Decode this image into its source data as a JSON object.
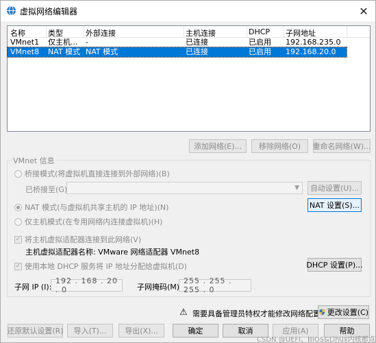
{
  "window": {
    "title": "虚拟网络编辑器",
    "close_glyph": "✕"
  },
  "table": {
    "columns": [
      "名称",
      "类型",
      "外部连接",
      "主机连接",
      "DHCP",
      "子网地址"
    ],
    "rows": [
      {
        "name": "VMnet1",
        "type": "仅主机...",
        "external": "-",
        "host": "已连接",
        "dhcp": "已启用",
        "subnet": "192.168.235.0",
        "selected": false
      },
      {
        "name": "VMnet8",
        "type": "NAT 模式",
        "external": "NAT 模式",
        "host": "已连接",
        "dhcp": "已启用",
        "subnet": "192.168.20.0",
        "selected": true
      }
    ]
  },
  "network_buttons": {
    "add": "添加网络(E)...",
    "remove": "移除网络(O)",
    "rename": "重命名网络(W)..."
  },
  "vmnet_info": {
    "group_title": "VMnet 信息",
    "bridge_label": "桥接模式(将虚拟机直接连接到外部网络)(B)",
    "bridged_to_label": "已桥接至(G):",
    "auto_settings": "自动设置(U)...",
    "nat_label": "NAT 模式(与虚拟机共享主机的 IP 地址)(N)",
    "nat_settings": "NAT 设置(S)...",
    "hostonly_label": "仅主机模式(在专用网络内连接虚拟机)(H)",
    "connect_adapter_label": "将主机虚拟适配器连接到此网络(V)",
    "adapter_name_label": "主机虚拟适配器名称: VMware 网络适配器 VMnet8",
    "dhcp_label": "使用本地 DHCP 服务将 IP 地址分配给虚拟机(D)",
    "dhcp_settings": "DHCP 设置(P)...",
    "subnet_ip_label": "子网 IP (I):",
    "subnet_ip_value": "192 . 168 . 20 . 0",
    "subnet_mask_label": "子网掩码(M):",
    "subnet_mask_value": "255 . 255 . 255 . 0"
  },
  "admin_notice": {
    "warning_glyph": "⚠",
    "text": "需要具备管理员特权才能修改网络配置。",
    "change_settings": "更改设置(C)"
  },
  "footer": {
    "restore_defaults": "还原默认设置(R)",
    "import": "导入(T)...",
    "export": "导出(X)...",
    "ok": "确定",
    "cancel": "取消",
    "apply": "应用(A)",
    "help": "帮助"
  },
  "watermark": "CSDN @UEFI、BIOS&Linux内核那点事",
  "colors": {
    "selection": "#0078d7",
    "window_bg": "#f0f0f0"
  }
}
